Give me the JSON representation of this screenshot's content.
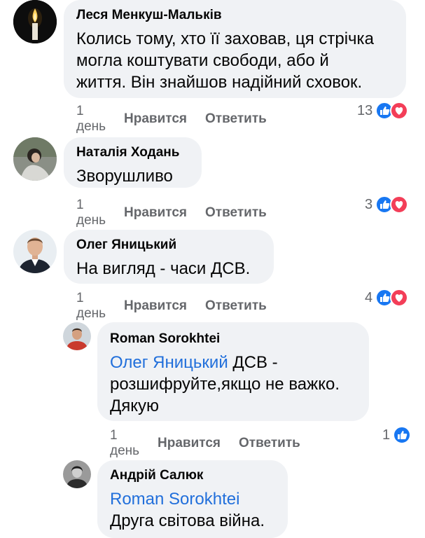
{
  "colors": {
    "bubble": "#f0f2f5",
    "mention": "#216fdb",
    "meta": "#65676b",
    "like": "#1877f2",
    "love": "#f33e58"
  },
  "comments": [
    {
      "author": "Леся Менкуш-Мальків",
      "avatar_icon": "candle-avatar",
      "lines": [
        "Колись тому, хто її заховав, ця стрічка",
        "могла коштувати свободи, або й",
        "життя. Він знайшов надійний сховок."
      ],
      "time": "1 день",
      "like": "Нравится",
      "reply": "Ответить",
      "reactions_count": "13",
      "reactions": [
        "like-icon",
        "love-icon"
      ]
    },
    {
      "author": "Наталія Ходань",
      "avatar_icon": "photo-avatar",
      "lines": [
        "Зворушливо"
      ],
      "time": "1 день",
      "like": "Нравится",
      "reply": "Ответить",
      "reactions_count": "3",
      "reactions": [
        "like-icon",
        "love-icon"
      ]
    },
    {
      "author": "Олег Яницький",
      "avatar_icon": "photo-avatar",
      "lines": [
        "На вигляд - часи ДСВ."
      ],
      "time": "1 день",
      "like": "Нравится",
      "reply": "Ответить",
      "reactions_count": "4",
      "reactions": [
        "like-icon",
        "love-icon"
      ]
    },
    {
      "author": "Roman Sorokhtei",
      "avatar_icon": "photo-avatar",
      "mention": "Олег Яницький",
      "lines": [
        " ДСВ -",
        "розшифруйте,якщо не важко.",
        "Дякую"
      ],
      "time": "1 день",
      "like": "Нравится",
      "reply": "Ответить",
      "reactions_count": "1",
      "reactions": [
        "like-icon"
      ]
    },
    {
      "author": "Андрій Салюк",
      "avatar_icon": "photo-avatar",
      "mention": "Roman Sorokhtei",
      "lines": [
        "Друга світова війна."
      ]
    }
  ]
}
